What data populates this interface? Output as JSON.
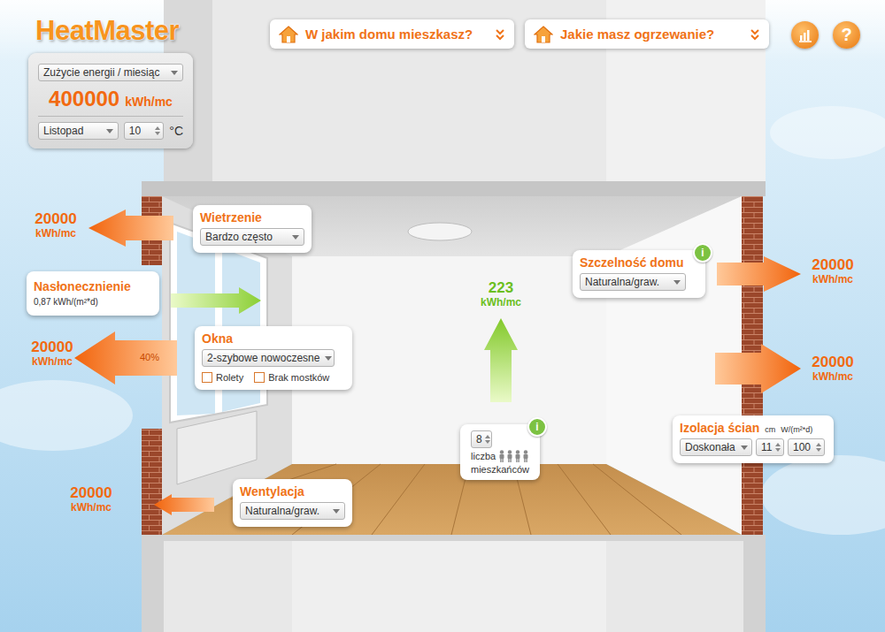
{
  "app": {
    "logo": "HeatMaster"
  },
  "top_menu": [
    {
      "label": "W jakim domu mieszkasz?"
    },
    {
      "label": "Jakie masz ogrzewanie?"
    }
  ],
  "help_button": {
    "label": "?"
  },
  "energy_panel": {
    "mode": "Zużycie energii / miesiąc",
    "value": "400000",
    "unit": "kWh/mc",
    "month": "Listopad",
    "temperature": "10",
    "temperature_unit": "°C"
  },
  "losses": [
    {
      "value": "20000",
      "unit": "kWh/mc"
    },
    {
      "value": "20000",
      "unit": "kWh/mc",
      "share": "40%"
    },
    {
      "value": "20000",
      "unit": "kWh/mc"
    },
    {
      "value": "20000",
      "unit": "kWh/mc"
    },
    {
      "value": "20000",
      "unit": "kWh/mc"
    }
  ],
  "airing": {
    "title": "Wietrzenie",
    "value": "Bardzo często"
  },
  "sunlight": {
    "title": "Nasłonecznienie",
    "value": "0,87 kWh/(m²*d)"
  },
  "windows": {
    "title": "Okna",
    "value": "2-szybowe nowoczesne",
    "options": [
      {
        "label": "Rolety",
        "checked": false
      },
      {
        "label": "Brak mostków",
        "checked": false
      }
    ]
  },
  "ventilation": {
    "title": "Wentylacja",
    "value": "Naturalna/graw."
  },
  "tightness": {
    "title": "Szczelność domu",
    "value": "Naturalna/graw.",
    "info": "i"
  },
  "insulation": {
    "title": "Izolacja ścian",
    "thickness_unit": "cm",
    "u_unit": "W/(m²*d)",
    "value": "Doskonała",
    "thickness": "11",
    "u_value": "100"
  },
  "residents": {
    "count": "8",
    "label_line1": "liczba",
    "label_line2": "mieszkańców",
    "info": "i",
    "heat": "223",
    "heat_unit": "kWh/mc"
  }
}
